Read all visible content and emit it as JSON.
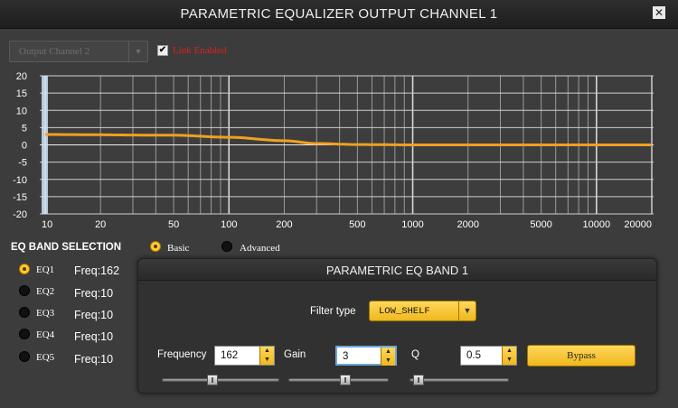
{
  "window": {
    "title": "PARAMETRIC EQUALIZER OUTPUT CHANNEL 1",
    "close_icon": "close-icon"
  },
  "channel_select": {
    "value": "Output Channel 2"
  },
  "link": {
    "label": "Link Enabled",
    "checked": true
  },
  "graph": {
    "y_ticks": [
      "20",
      "15",
      "10",
      "5",
      "0",
      "-5",
      "-10",
      "-15",
      "-20"
    ],
    "y_values": [
      20,
      15,
      10,
      5,
      0,
      -5,
      -10,
      -15,
      -20
    ],
    "x_ticks": [
      "10",
      "20",
      "50",
      "100",
      "200",
      "500",
      "1000",
      "2000",
      "5000",
      "10000",
      "20000"
    ],
    "x_values": [
      10,
      20,
      50,
      100,
      200,
      500,
      1000,
      2000,
      5000,
      10000,
      20000
    ],
    "curve_color": "#f0a020",
    "response": [
      [
        10,
        3
      ],
      [
        50,
        2.8
      ],
      [
        100,
        2.2
      ],
      [
        200,
        1.2
      ],
      [
        300,
        0.4
      ],
      [
        500,
        0.1
      ],
      [
        1000,
        0
      ],
      [
        20000,
        0
      ]
    ]
  },
  "eq_band_selection": {
    "label": "EQ BAND SELECTION",
    "mode_basic": "Basic",
    "mode_advanced": "Advanced",
    "selected_mode": "Basic",
    "bands": [
      {
        "name": "EQ1",
        "freq": "Freq:162",
        "selected": true
      },
      {
        "name": "EQ2",
        "freq": "Freq:10",
        "selected": false
      },
      {
        "name": "EQ3",
        "freq": "Freq:10",
        "selected": false
      },
      {
        "name": "EQ4",
        "freq": "Freq:10",
        "selected": false
      },
      {
        "name": "EQ5",
        "freq": "Freq:10",
        "selected": false
      }
    ]
  },
  "band_panel": {
    "title": "PARAMETRIC EQ BAND 1",
    "filter_type_label": "Filter type",
    "filter_type_value": "LOW_SHELF",
    "frequency_label": "Frequency",
    "frequency_value": "162",
    "gain_label": "Gain",
    "gain_value": "3",
    "q_label": "Q",
    "q_value": "0.5",
    "bypass_label": "Bypass",
    "sliders": {
      "frequency": 0.42,
      "gain": 0.58,
      "q": 0.04
    }
  }
}
